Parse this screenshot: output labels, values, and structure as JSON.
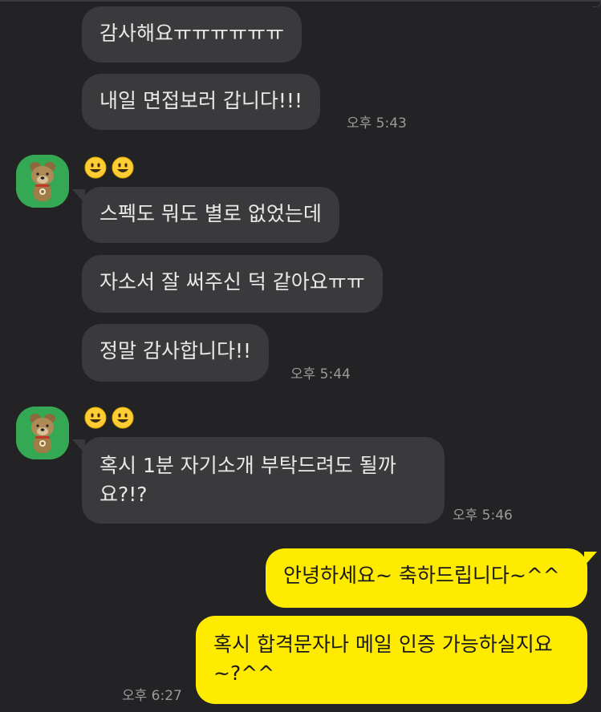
{
  "sender": {
    "emoji_name": [
      "😃",
      "😃"
    ],
    "avatar_icon": "bear-character-avatar"
  },
  "messages": [
    {
      "text": "감사해요ㅠㅠㅠㅠㅠㅠ"
    },
    {
      "text": "내일 면접보러 갑니다!!!",
      "time": "오후 5:43"
    },
    {
      "text": "스펙도 뭐도 별로 없었는데"
    },
    {
      "text": "자소서 잘 써주신 덕 같아요ㅠㅠ"
    },
    {
      "text": "정말 감사합니다!!",
      "time": "오후 5:44"
    },
    {
      "text": "혹시 1분 자기소개 부탁드려도 될까요?!?",
      "time": "오후 5:46"
    },
    {
      "text": "안녕하세요~ 축하드립니다~^^"
    },
    {
      "text": "혹시 합격문자나 메일 인증 가능하실지요~?^^",
      "time": "오후 6:27"
    }
  ],
  "colors": {
    "background": "#232325",
    "incoming_bubble": "#3a3a3c",
    "outgoing_bubble": "#ffeb00",
    "avatar_bg": "#34a853",
    "timestamp": "#9a9a9a"
  }
}
